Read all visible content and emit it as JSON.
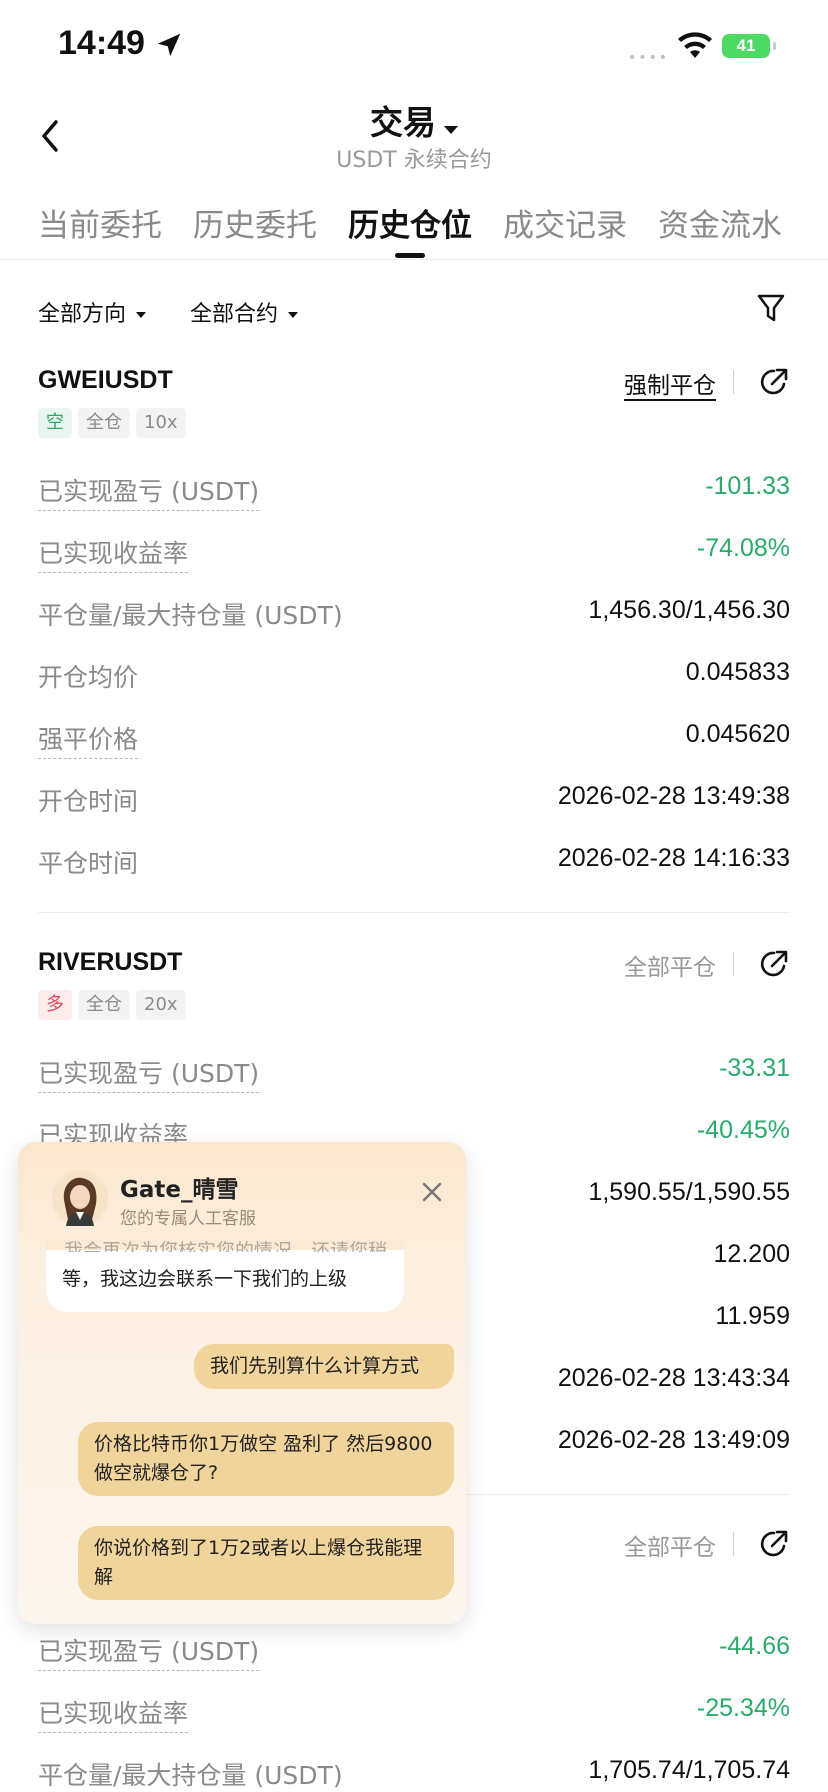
{
  "status": {
    "time": "14:49",
    "battery": "41",
    "signal_dots": "••••"
  },
  "header": {
    "title": "交易",
    "subtitle": "USDT 永续合约"
  },
  "tabs": [
    {
      "label": "当前委托"
    },
    {
      "label": "历史委托"
    },
    {
      "label": "历史仓位"
    },
    {
      "label": "成交记录"
    },
    {
      "label": "资金流水"
    }
  ],
  "active_tab": "历史仓位",
  "filters": {
    "direction": "全部方向",
    "contract": "全部合约"
  },
  "positions": [
    {
      "symbol": "GWEIUSDT",
      "close_type": "强制平仓",
      "side": "空",
      "margin_mode": "全仓",
      "leverage": "10x",
      "rows": [
        {
          "label": "已实现盈亏 (USDT)",
          "value": "-101.33"
        },
        {
          "label": "已实现收益率",
          "value": "-74.08%"
        },
        {
          "label": "平仓量/最大持仓量 (USDT)",
          "value": "1,456.30/1,456.30"
        },
        {
          "label": "开仓均价",
          "value": "0.045833"
        },
        {
          "label": "强平价格",
          "value": "0.045620"
        },
        {
          "label": "开仓时间",
          "value": "2026-02-28 13:49:38"
        },
        {
          "label": "平仓时间",
          "value": "2026-02-28 14:16:33"
        }
      ]
    },
    {
      "symbol": "RIVERUSDT",
      "close_type": "全部平仓",
      "side": "多",
      "margin_mode": "全仓",
      "leverage": "20x",
      "rows": [
        {
          "label": "已实现盈亏 (USDT)",
          "value": "-33.31"
        },
        {
          "label": "已实现收益率",
          "value": "-40.45%"
        },
        {
          "label": "",
          "value": "1,590.55/1,590.55"
        },
        {
          "label": "",
          "value": "12.200"
        },
        {
          "label": "",
          "value": "11.959"
        },
        {
          "label": "",
          "value": "2026-02-28 13:43:34"
        },
        {
          "label": "",
          "value": "2026-02-28 13:49:09"
        }
      ]
    },
    {
      "symbol": "",
      "close_type": "全部平仓",
      "rows": [
        {
          "label": "已实现盈亏 (USDT)",
          "value": "-44.66"
        },
        {
          "label": "已实现收益率",
          "value": "-25.34%"
        },
        {
          "label": "平仓量/最大持仓量 (USDT)",
          "value": "1,705.74/1,705.74"
        }
      ]
    }
  ],
  "chat": {
    "agent_name": "Gate_晴雪",
    "agent_subtitle": "您的专属人工客服",
    "ghost_line": "我会再次为您核实您的情况，还请您稍",
    "agent_message": "等，我这边会联系一下我们的上级",
    "user_messages": [
      "我们先别算什么计算方式",
      "价格比特币你1万做空 盈利了 然后9800做空就爆仓了?",
      "你说价格到了1万2或者以上爆仓我能理解"
    ]
  },
  "colors": {
    "loss_green": "#2aaa6b",
    "short_tag": "#2aaa6b",
    "long_tag": "#e0495b",
    "user_bubble": "#f0d49c",
    "battery": "#4cd964"
  }
}
